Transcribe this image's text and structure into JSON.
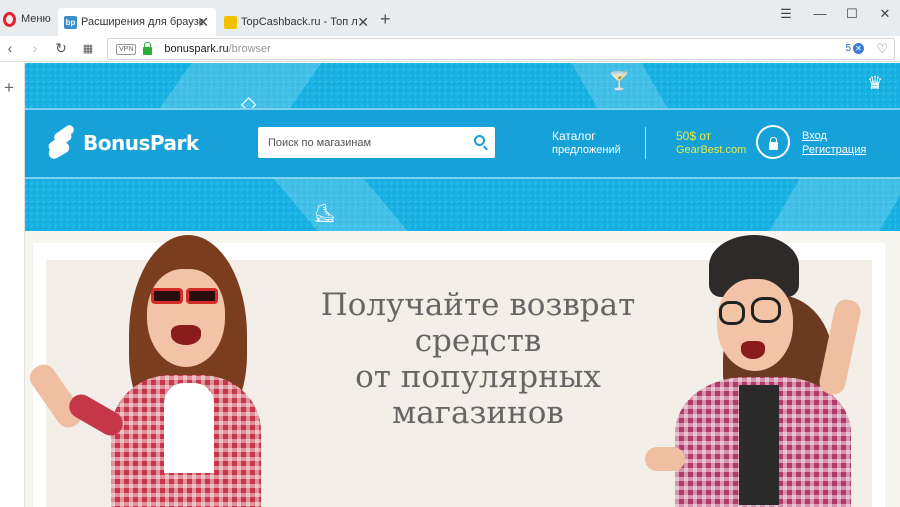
{
  "browser": {
    "menu_label": "Меню",
    "tabs": [
      {
        "title": "Расширения для браузер",
        "favicon": "bp",
        "active": true
      },
      {
        "title": "TopCashback.ru - Топ луч",
        "favicon": "lock-icon",
        "active": false
      }
    ],
    "new_tab": "+",
    "address": {
      "vpn_label": "VPN",
      "host": "bonuspark.ru",
      "path": "/browser",
      "extension_count": "5"
    }
  },
  "site": {
    "logo_text": "BonusPark",
    "search": {
      "placeholder": "Поиск по магазинам"
    },
    "catalog": {
      "line1": "Каталог",
      "line2": "предложений"
    },
    "promo": {
      "line1": "50$ от",
      "line2": "GearBest.com"
    },
    "auth": {
      "login": "Вход",
      "register": "Регистрация"
    },
    "hero": {
      "line1": "Получайте возврат",
      "line2": "средств",
      "line3": "от популярных",
      "line4": "магазинов"
    },
    "colors": {
      "brand_blue": "#16a1d8",
      "promo_yellow": "#e8ea4b",
      "opera_red": "#e5212d"
    }
  }
}
